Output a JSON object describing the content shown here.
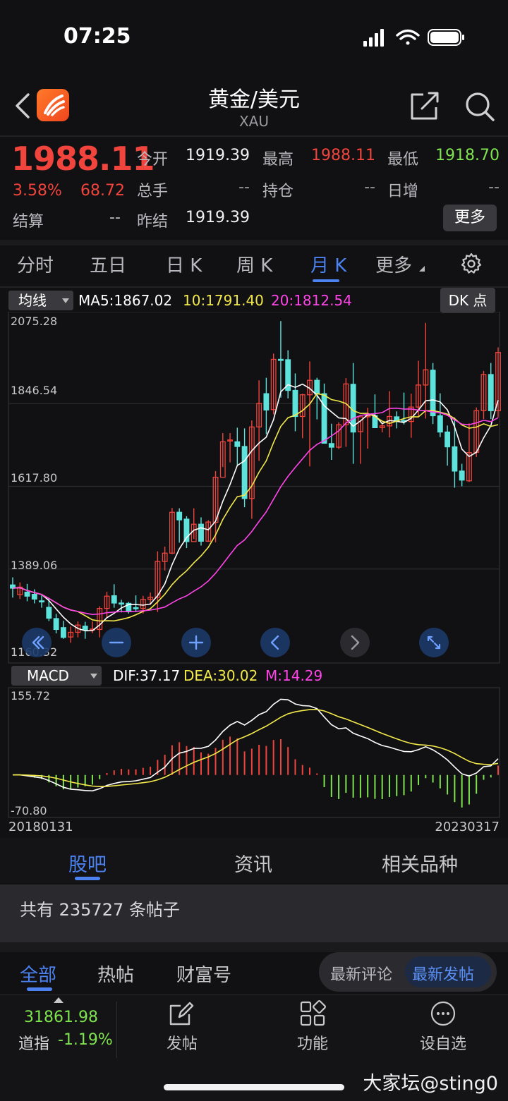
{
  "status_bar": {
    "time": "07:25"
  },
  "header": {
    "title": "黄金/美元",
    "subtitle": "XAU"
  },
  "quote": {
    "price": "1988.11",
    "change_pct": "3.58%",
    "change_abs": "68.72",
    "open_label": "今开",
    "open_value": "1919.39",
    "high_label": "最高",
    "high_value": "1988.11",
    "low_label": "最低",
    "low_value": "1918.70",
    "volume_label": "总手",
    "volume_value": "--",
    "position_label": "持仓",
    "position_value": "--",
    "daily_inc_label": "日增",
    "daily_inc_value": "--",
    "settle_label": "结算",
    "settle_value": "--",
    "prev_settle_label": "昨结",
    "prev_settle_value": "1919.39",
    "more_label": "更多"
  },
  "period_tabs": [
    {
      "label": "分时"
    },
    {
      "label": "五日"
    },
    {
      "label": "日 K"
    },
    {
      "label": "周 K"
    },
    {
      "label": "月 K",
      "active": true
    },
    {
      "label": "更多"
    }
  ],
  "indicator_bar": {
    "select_label": "均线",
    "ma5": "MA5:1867.02",
    "ma10": "10:1791.40",
    "ma20": "20:1812.54",
    "dk_label": "DK 点"
  },
  "macd_bar": {
    "select_label": "MACD",
    "dif": "DIF:37.17",
    "dea": "DEA:30.02",
    "m": "M:14.29"
  },
  "chart_data": [
    {
      "type": "candlestick",
      "y_ticks": [
        "2075.28",
        "1846.54",
        "1617.80",
        "1389.06",
        "1160.32"
      ],
      "ylim": [
        1160.32,
        2075.28
      ],
      "x_start": "20180131",
      "x_end": "20230317",
      "series": [
        {
          "name": "MA5",
          "color": "#ffffff",
          "last": 1867.02
        },
        {
          "name": "10",
          "color": "#f2e94a",
          "last": 1791.4
        },
        {
          "name": "20",
          "color": "#ff44e8",
          "last": 1812.54
        }
      ],
      "candles": [
        [
          1345,
          1336,
          1366,
          1310
        ],
        [
          1318,
          1339,
          1352,
          1306
        ],
        [
          1325,
          1314,
          1348,
          1300
        ],
        [
          1319,
          1306,
          1333,
          1294
        ],
        [
          1301,
          1298,
          1316,
          1282
        ],
        [
          1283,
          1253,
          1309,
          1245
        ],
        [
          1252,
          1222,
          1265,
          1211
        ],
        [
          1227,
          1200,
          1246,
          1196
        ],
        [
          1201,
          1214,
          1230,
          1185
        ],
        [
          1214,
          1234,
          1244,
          1200
        ],
        [
          1231,
          1221,
          1243,
          1196
        ],
        [
          1221,
          1223,
          1244,
          1212
        ],
        [
          1222,
          1280,
          1286,
          1200
        ],
        [
          1280,
          1314,
          1326,
          1255
        ],
        [
          1315,
          1295,
          1347,
          1282
        ],
        [
          1295,
          1294,
          1304,
          1269
        ],
        [
          1294,
          1271,
          1298,
          1266
        ],
        [
          1282,
          1280,
          1316,
          1270
        ],
        [
          1280,
          1305,
          1315,
          1266
        ],
        [
          1305,
          1311,
          1324,
          1290
        ],
        [
          1311,
          1410,
          1438,
          1270
        ],
        [
          1410,
          1433,
          1451,
          1385
        ],
        [
          1433,
          1546,
          1558,
          1430
        ],
        [
          1546,
          1525,
          1557,
          1462
        ],
        [
          1527,
          1465,
          1535,
          1447
        ],
        [
          1465,
          1513,
          1557,
          1472
        ],
        [
          1513,
          1466,
          1532,
          1454
        ],
        [
          1466,
          1519,
          1524,
          1464
        ],
        [
          1518,
          1643,
          1660,
          1463
        ],
        [
          1643,
          1741,
          1765,
          1671
        ],
        [
          1745,
          1746,
          1765,
          1684
        ],
        [
          1741,
          1728,
          1780,
          1677
        ],
        [
          1728,
          1584,
          1778,
          1560
        ],
        [
          1584,
          1782,
          1800,
          1528
        ],
        [
          1782,
          1847,
          1911,
          1688
        ],
        [
          1874,
          1829,
          1918,
          1762
        ],
        [
          1830,
          1969,
          1985,
          1817
        ],
        [
          1969,
          1967,
          2075,
          1863
        ],
        [
          1968,
          1883,
          1994,
          1861
        ],
        [
          1883,
          1811,
          1930,
          1770
        ],
        [
          1811,
          1871,
          1874,
          1751
        ],
        [
          1871,
          1911,
          1963,
          1673
        ],
        [
          1911,
          1873,
          1918,
          1803
        ],
        [
          1874,
          1737,
          1902,
          1740
        ],
        [
          1736,
          1726,
          1791,
          1691
        ],
        [
          1726,
          1788,
          1795,
          1721
        ],
        [
          1788,
          1901,
          1917,
          1727
        ],
        [
          1900,
          1768,
          1959,
          1680
        ],
        [
          1769,
          1810,
          1799,
          1680
        ],
        [
          1810,
          1813,
          1835,
          1722
        ],
        [
          1813,
          1780,
          1872,
          1779
        ],
        [
          1780,
          1785,
          1794,
          1767
        ],
        [
          1785,
          1811,
          1881,
          1753
        ],
        [
          1810,
          1799,
          1825,
          1778
        ],
        [
          1800,
          1797,
          1877,
          1789
        ],
        [
          1797,
          1837,
          1874,
          1752
        ],
        [
          1837,
          1898,
          1965,
          1811
        ],
        [
          1898,
          1940,
          2070,
          1805
        ],
        [
          1939,
          1813,
          1959,
          1790
        ],
        [
          1813,
          1768,
          1875,
          1754
        ],
        [
          1768,
          1727,
          1786,
          1675
        ],
        [
          1727,
          1660,
          1808,
          1614
        ],
        [
          1660,
          1635,
          1680,
          1618
        ],
        [
          1633,
          1711,
          1792,
          1630
        ],
        [
          1712,
          1827,
          1836,
          1699
        ],
        [
          1827,
          1927,
          1937,
          1804
        ],
        [
          1927,
          1827,
          1959,
          1804
        ],
        [
          1827,
          1988,
          2002,
          1809
        ]
      ]
    },
    {
      "type": "macd",
      "y_ticks": [
        "155.72",
        "-70.80"
      ],
      "ylim": [
        -70.8,
        155.72
      ],
      "dif_last": 37.17,
      "dea_last": 30.02,
      "m_last": 14.29
    }
  ],
  "community_tabs": [
    {
      "label": "股吧",
      "active": true
    },
    {
      "label": "资讯"
    },
    {
      "label": "相关品种"
    }
  ],
  "post_count_text": "共有 235727 条帖子",
  "feed_tabs": [
    {
      "label": "全部",
      "active": true
    },
    {
      "label": "热帖"
    },
    {
      "label": "财富号"
    }
  ],
  "sort_options": {
    "latest_comment": "最新评论",
    "latest_post": "最新发帖"
  },
  "bottom_bar": {
    "index_value": "31861.98",
    "index_name": "道指",
    "index_change": "-1.19%",
    "post_label": "发帖",
    "function_label": "功能",
    "watchlist_label": "设自选"
  },
  "watermark": "大家坛@sting0",
  "colors": {
    "up": "#f0443c",
    "down": "#5ee2dc",
    "accent": "#4b82f0",
    "ma5": "#ffffff",
    "ma10": "#f2e94a",
    "ma20": "#ff44e8",
    "macd_pos": "#f0443c",
    "macd_neg": "#7ee34f"
  }
}
